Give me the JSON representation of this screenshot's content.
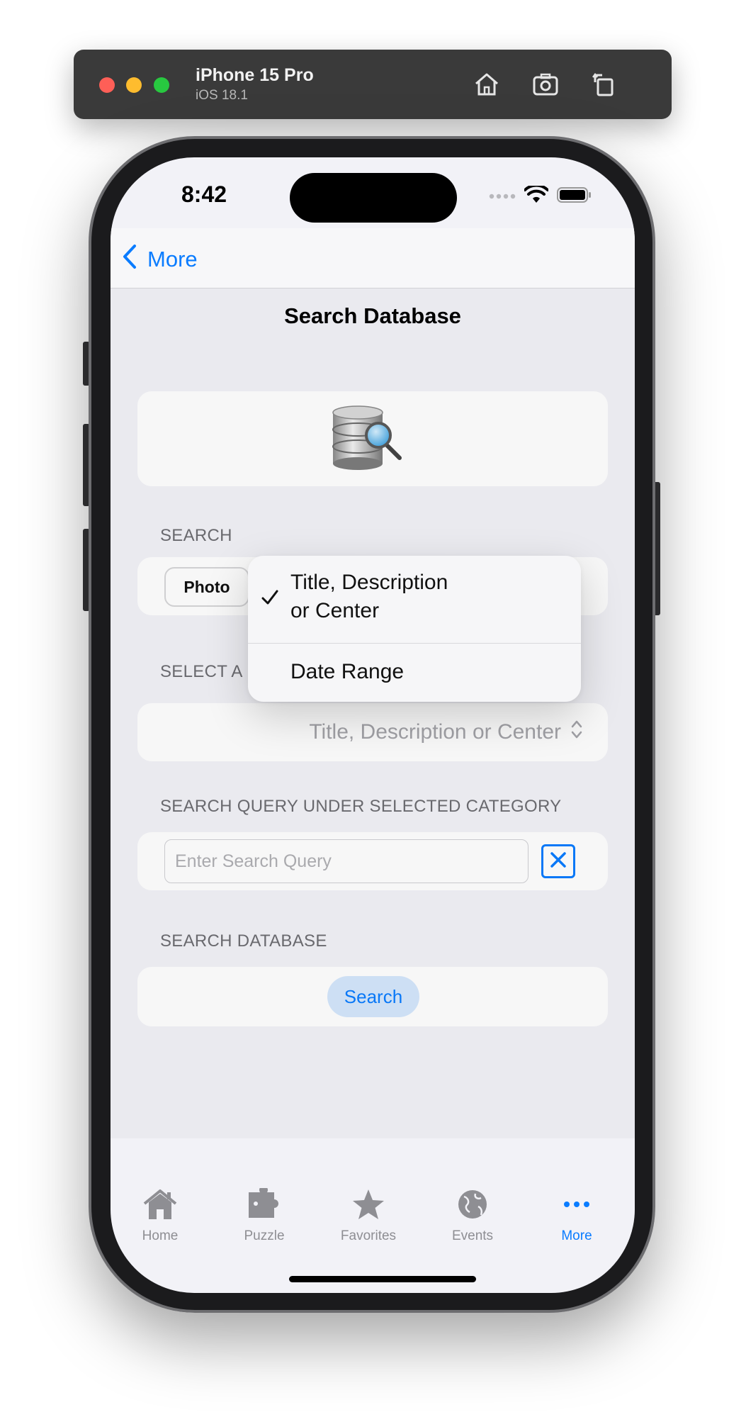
{
  "simulator": {
    "device": "iPhone 15 Pro",
    "os": "iOS 18.1"
  },
  "status_bar": {
    "time": "8:42"
  },
  "nav": {
    "back_label": "More",
    "title": "Search Database"
  },
  "search_section": {
    "label": "SEARCH",
    "segment_visible_label": "Photo"
  },
  "category_section": {
    "label": "SELECT A",
    "selected_value": "Title, Description or Center"
  },
  "dropdown_menu": {
    "items": [
      {
        "label_line1": "Title, Description",
        "label_line2": "or Center",
        "checked": true
      },
      {
        "label_line1": "Date Range",
        "checked": false
      }
    ]
  },
  "query_section": {
    "label": "SEARCH QUERY UNDER SELECTED CATEGORY",
    "placeholder": "Enter Search Query",
    "value": ""
  },
  "database_section": {
    "label": "SEARCH DATABASE",
    "button_label": "Search"
  },
  "tab_bar": {
    "items": [
      {
        "label": "Home",
        "icon": "house-icon",
        "active": false
      },
      {
        "label": "Puzzle",
        "icon": "puzzle-piece-icon",
        "active": false
      },
      {
        "label": "Favorites",
        "icon": "star-icon",
        "active": false
      },
      {
        "label": "Events",
        "icon": "globe-icon",
        "active": false
      },
      {
        "label": "More",
        "icon": "ellipsis-icon",
        "active": true
      }
    ]
  },
  "colors": {
    "accent": "#0a7cff",
    "background": "#f2f2f7",
    "inactive_tab": "#8e8e93"
  }
}
